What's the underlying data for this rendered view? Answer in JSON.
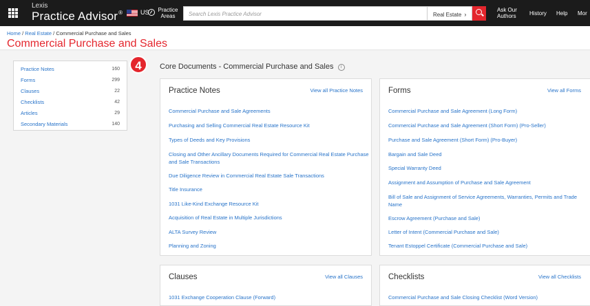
{
  "topbar": {
    "brand_small": "Lexis",
    "brand_big": "Practice Advisor",
    "brand_reg": "®",
    "region": "US",
    "practice_areas": [
      "Practice",
      "Areas"
    ],
    "search_placeholder": "Search Lexis Practice Advisor",
    "search_scope": "Real Estate",
    "scope_chevron": "›",
    "nav_ask": [
      "Ask Our",
      "Authors"
    ],
    "nav_history": "History",
    "nav_help": "Help",
    "nav_more": "Mor"
  },
  "header": {
    "breadcrumb": [
      "Home",
      "Real Estate",
      "Commercial Purchase and Sales"
    ],
    "separator": " / ",
    "title": "Commercial Purchase and Sales"
  },
  "sidebar": {
    "items": [
      {
        "label": "Practice Notes",
        "count": "160"
      },
      {
        "label": "Forms",
        "count": "299"
      },
      {
        "label": "Clauses",
        "count": "22"
      },
      {
        "label": "Checklists",
        "count": "42"
      },
      {
        "label": "Articles",
        "count": "29"
      },
      {
        "label": "Secondary Materials",
        "count": "140"
      }
    ]
  },
  "step_badge": "4",
  "core_title": "Core Documents - Commercial Purchase and Sales",
  "info_icon": "i",
  "cards": {
    "practice_notes": {
      "title": "Practice Notes",
      "view_all": "View all Practice Notes",
      "links": [
        "Commercial Purchase and Sale Agreements",
        "Purchasing and Selling Commercial Real Estate Resource Kit",
        "Types of Deeds and Key Provisions",
        "Closing and Other Ancillary Documents Required for Commercial Real Estate Purchase and Sale Transactions",
        "Due Diligence Review in Commercial Real Estate Sale Transactions",
        "Title Insurance",
        "1031 Like-Kind Exchange Resource Kit",
        "Acquisition of Real Estate in Multiple Jurisdictions",
        "ALTA Survey Review",
        "Planning and Zoning"
      ]
    },
    "forms": {
      "title": "Forms",
      "view_all": "View all Forms",
      "links": [
        "Commercial Purchase and Sale Agreement (Long Form)",
        "Commercial Purchase and Sale Agreement (Short Form) (Pro-Seller)",
        "Purchase and Sale Agreement (Short Form) (Pro-Buyer)",
        "Bargain and Sale Deed",
        "Special Warranty Deed",
        "Assignment and Assumption of Purchase and Sale Agreement",
        "Bill of Sale and Assignment of Service Agreements, Warranties, Permits and Trade Name",
        "Escrow Agreement (Purchase and Sale)",
        "Letter of Intent (Commercial Purchase and Sale)",
        "Tenant Estoppel Certificate (Commercial Purchase and Sale)"
      ]
    },
    "clauses": {
      "title": "Clauses",
      "view_all": "View all Clauses",
      "links": [
        "1031 Exchange Cooperation Clause (Forward)"
      ]
    },
    "checklists": {
      "title": "Checklists",
      "view_all": "View all Checklists",
      "links": [
        "Commercial Purchase and Sale Closing Checklist (Word Version)"
      ]
    }
  }
}
